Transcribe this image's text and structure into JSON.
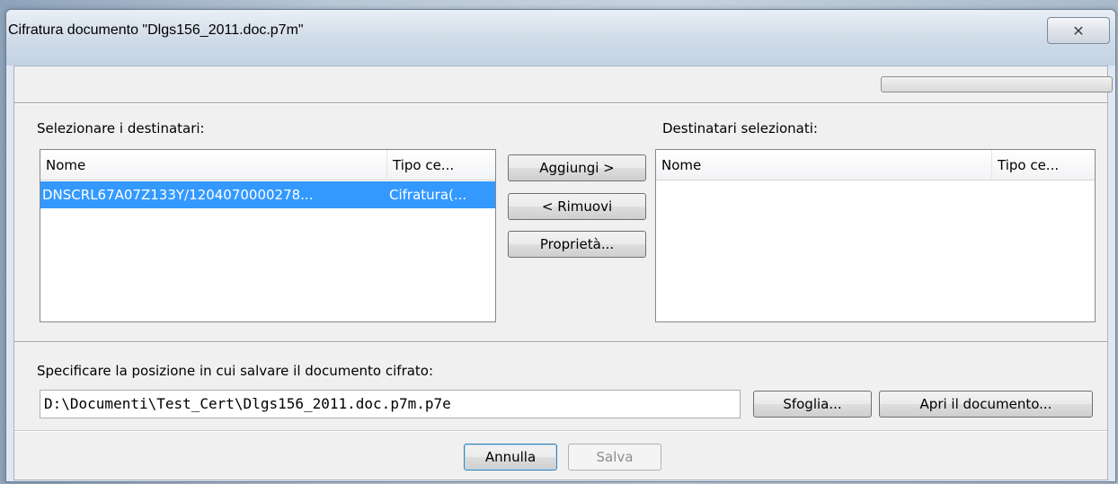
{
  "window": {
    "title": "Cifratura documento \"Dlgs156_2011.doc.p7m\"",
    "close_glyph": "✕",
    "progress_value": 0
  },
  "available": {
    "label": "Selezionare i destinatari:",
    "columns": [
      "Nome",
      "Tipo ce..."
    ],
    "rows": [
      {
        "name": "DNSCRL67A07Z133Y/1204070000278...",
        "type": "Cifratura(...",
        "selected": true
      }
    ]
  },
  "selected_list": {
    "label": "Destinatari selezionati:",
    "columns": [
      "Nome",
      "Tipo ce..."
    ],
    "rows": []
  },
  "actions": {
    "add": "Aggiungi >",
    "remove": "< Rimuovi",
    "properties": "Proprietà..."
  },
  "save_location": {
    "label": "Specificare la posizione in cui salvare il documento cifrato:",
    "path": "D:\\Documenti\\Test_Cert\\Dlgs156_2011.doc.p7m.p7e",
    "browse": "Sfoglia...",
    "open_document": "Apri il documento..."
  },
  "footer": {
    "cancel": "Annulla",
    "save": "Salva"
  },
  "colors": {
    "selection": "#3399ff",
    "progress": "#2fb83a"
  }
}
